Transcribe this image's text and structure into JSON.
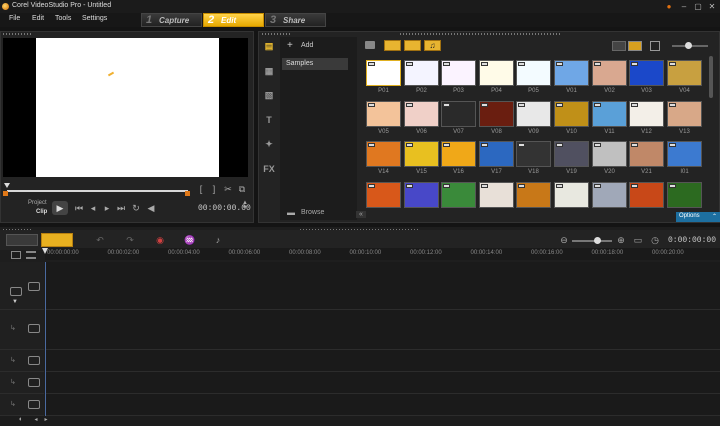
{
  "window": {
    "title": "Corel VideoStudio Pro - Untitled"
  },
  "menu": [
    "File",
    "Edit",
    "Tools",
    "Settings"
  ],
  "steps": [
    {
      "num": "1",
      "label": "Capture"
    },
    {
      "num": "2",
      "label": "Edit"
    },
    {
      "num": "3",
      "label": "Share"
    }
  ],
  "preview": {
    "mode_project": "Project",
    "mode_clip": "Clip",
    "timecode": "00:00:00.00"
  },
  "library": {
    "add_label": "Add",
    "folder": "Samples",
    "browse_label": "Browse",
    "options_label": "Options",
    "thumbs": [
      {
        "label": "P01",
        "bg": "#ffffff",
        "selected": true
      },
      {
        "label": "P02",
        "bg": "#f4f4ff"
      },
      {
        "label": "P03",
        "bg": "#fbf3ff"
      },
      {
        "label": "P04",
        "bg": "#fffbe8"
      },
      {
        "label": "P05",
        "bg": "#f3fbff"
      },
      {
        "label": "V01",
        "bg": "#6fa7e6"
      },
      {
        "label": "V02",
        "bg": "#d9a890"
      },
      {
        "label": "V03",
        "bg": "#1b48c9"
      },
      {
        "label": "V04",
        "bg": "#c8a040"
      },
      {
        "label": "V05",
        "bg": "#f3c39a"
      },
      {
        "label": "V06",
        "bg": "#f0d0c8"
      },
      {
        "label": "V07",
        "bg": "#2a2a2a"
      },
      {
        "label": "V08",
        "bg": "#6a1e10"
      },
      {
        "label": "V09",
        "bg": "#e8e8e8"
      },
      {
        "label": "V10",
        "bg": "#c09018"
      },
      {
        "label": "V11",
        "bg": "#5aa0d8"
      },
      {
        "label": "V12",
        "bg": "#f3efe8"
      },
      {
        "label": "V13",
        "bg": "#d8a888"
      },
      {
        "label": "V14",
        "bg": "#e07820"
      },
      {
        "label": "V15",
        "bg": "#e8c020"
      },
      {
        "label": "V16",
        "bg": "#f0a818"
      },
      {
        "label": "V17",
        "bg": "#2c68c0"
      },
      {
        "label": "V18",
        "bg": "#333333"
      },
      {
        "label": "V19",
        "bg": "#505060"
      },
      {
        "label": "V20",
        "bg": "#c0c0c0"
      },
      {
        "label": "V21",
        "bg": "#c08868"
      },
      {
        "label": "I01",
        "bg": "#3c7ad0"
      },
      {
        "label": "",
        "bg": "#d8581a"
      },
      {
        "label": "",
        "bg": "#4848c8"
      },
      {
        "label": "",
        "bg": "#3a8a3a"
      },
      {
        "label": "",
        "bg": "#e8e0d8"
      },
      {
        "label": "",
        "bg": "#c87818"
      },
      {
        "label": "",
        "bg": "#e8e8e0"
      },
      {
        "label": "",
        "bg": "#a0a8b8"
      },
      {
        "label": "",
        "bg": "#c84818"
      },
      {
        "label": "",
        "bg": "#2c6a20"
      }
    ]
  },
  "timeline": {
    "timecode": "0:00:00:00",
    "ruler": [
      "00:00:00:00",
      "00:00:02:00",
      "00:00:04:00",
      "00:00:06:00",
      "00:00:08:00",
      "00:00:10:00",
      "00:00:12:00",
      "00:00:14:00",
      "00:00:16:00",
      "00:00:18:00",
      "00:00:20:00"
    ]
  }
}
